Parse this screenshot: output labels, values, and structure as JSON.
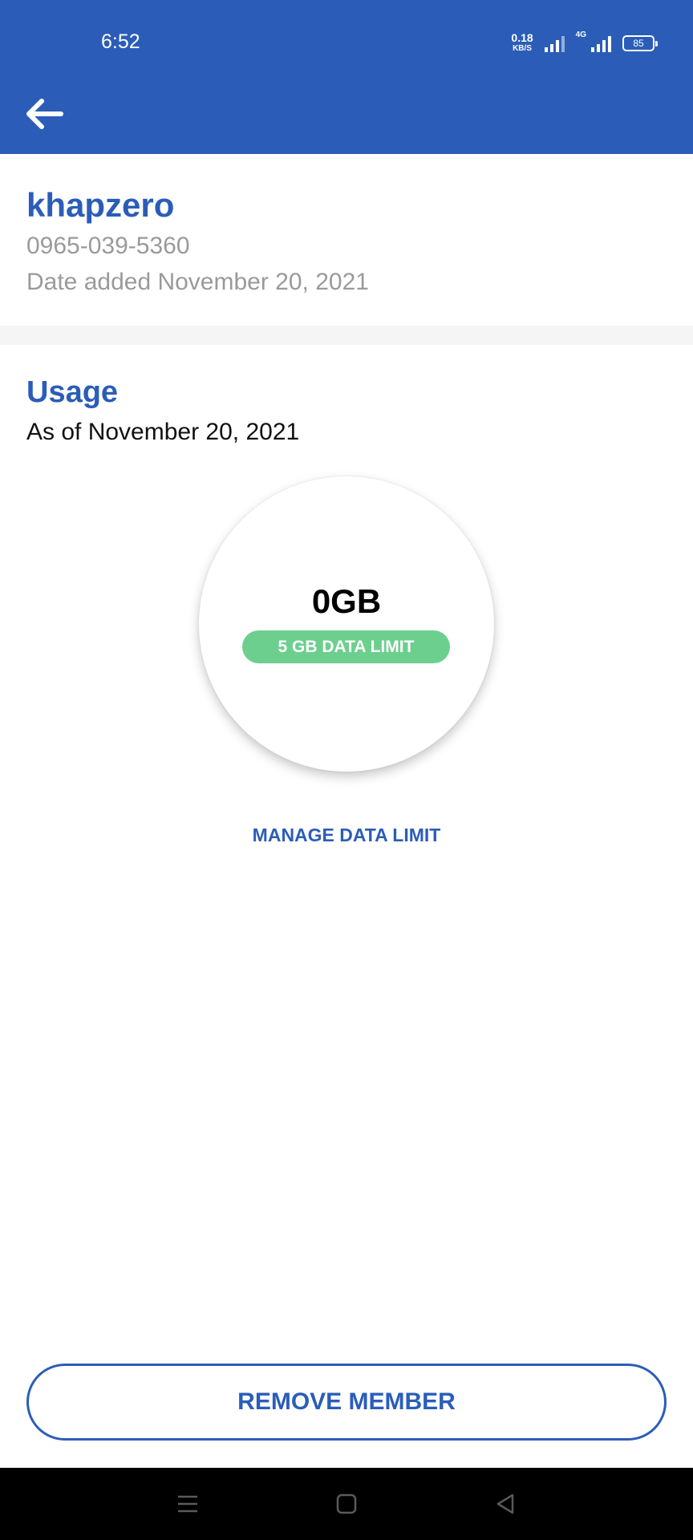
{
  "status_bar": {
    "time": "6:52",
    "net_speed_value": "0.18",
    "net_speed_unit": "KB/S",
    "network_type": "4G",
    "battery": "85"
  },
  "header": {
    "back_icon": "arrow-left-icon"
  },
  "member": {
    "name": "khapzero",
    "phone": "0965-039-5360",
    "date_added": "Date added November 20, 2021"
  },
  "usage": {
    "title": "Usage",
    "as_of": "As of November 20, 2021",
    "used": "0GB",
    "limit_label": "5 GB DATA LIMIT",
    "manage_label": "MANAGE DATA LIMIT"
  },
  "actions": {
    "remove_label": "REMOVE MEMBER"
  },
  "colors": {
    "brand": "#2b5db8",
    "limit_pill": "#6ccf8e",
    "muted_text": "#9a9a9a"
  },
  "system_nav": {
    "icons": [
      "menu-icon",
      "home-icon",
      "back-triangle-icon"
    ]
  }
}
